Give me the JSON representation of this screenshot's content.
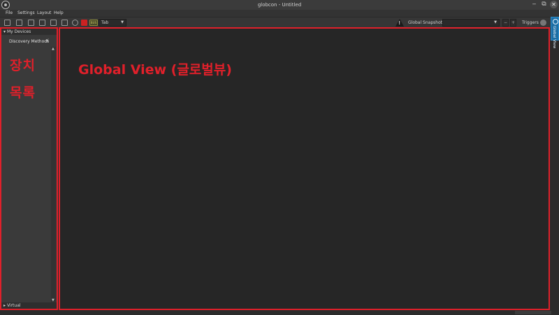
{
  "window": {
    "title": "globcon - Untitled"
  },
  "menu": [
    "File",
    "Settings",
    "Layout",
    "Help"
  ],
  "toolbar": {
    "bus_label": "BUS",
    "layout_dropdown": "Tab",
    "snapshots_label": "Global Snapshots",
    "snapshot_value": "",
    "minus_label": "−",
    "plus_label": "+",
    "triggers_label": "Triggers"
  },
  "side_tab": {
    "label": "Global View"
  },
  "devices_panel": {
    "header": "My Devices",
    "discovery_label": "Discovery Methods",
    "footer": "Virtual",
    "annotation_line1": "장치",
    "annotation_line2": "목록"
  },
  "main_view": {
    "annotation": "Global View (글로벌뷰)"
  },
  "colors": {
    "annotation_red": "#e0202a",
    "side_tab_blue": "#1c6ea4",
    "panel_bg": "#3a3a3a",
    "view_bg": "#262626"
  }
}
